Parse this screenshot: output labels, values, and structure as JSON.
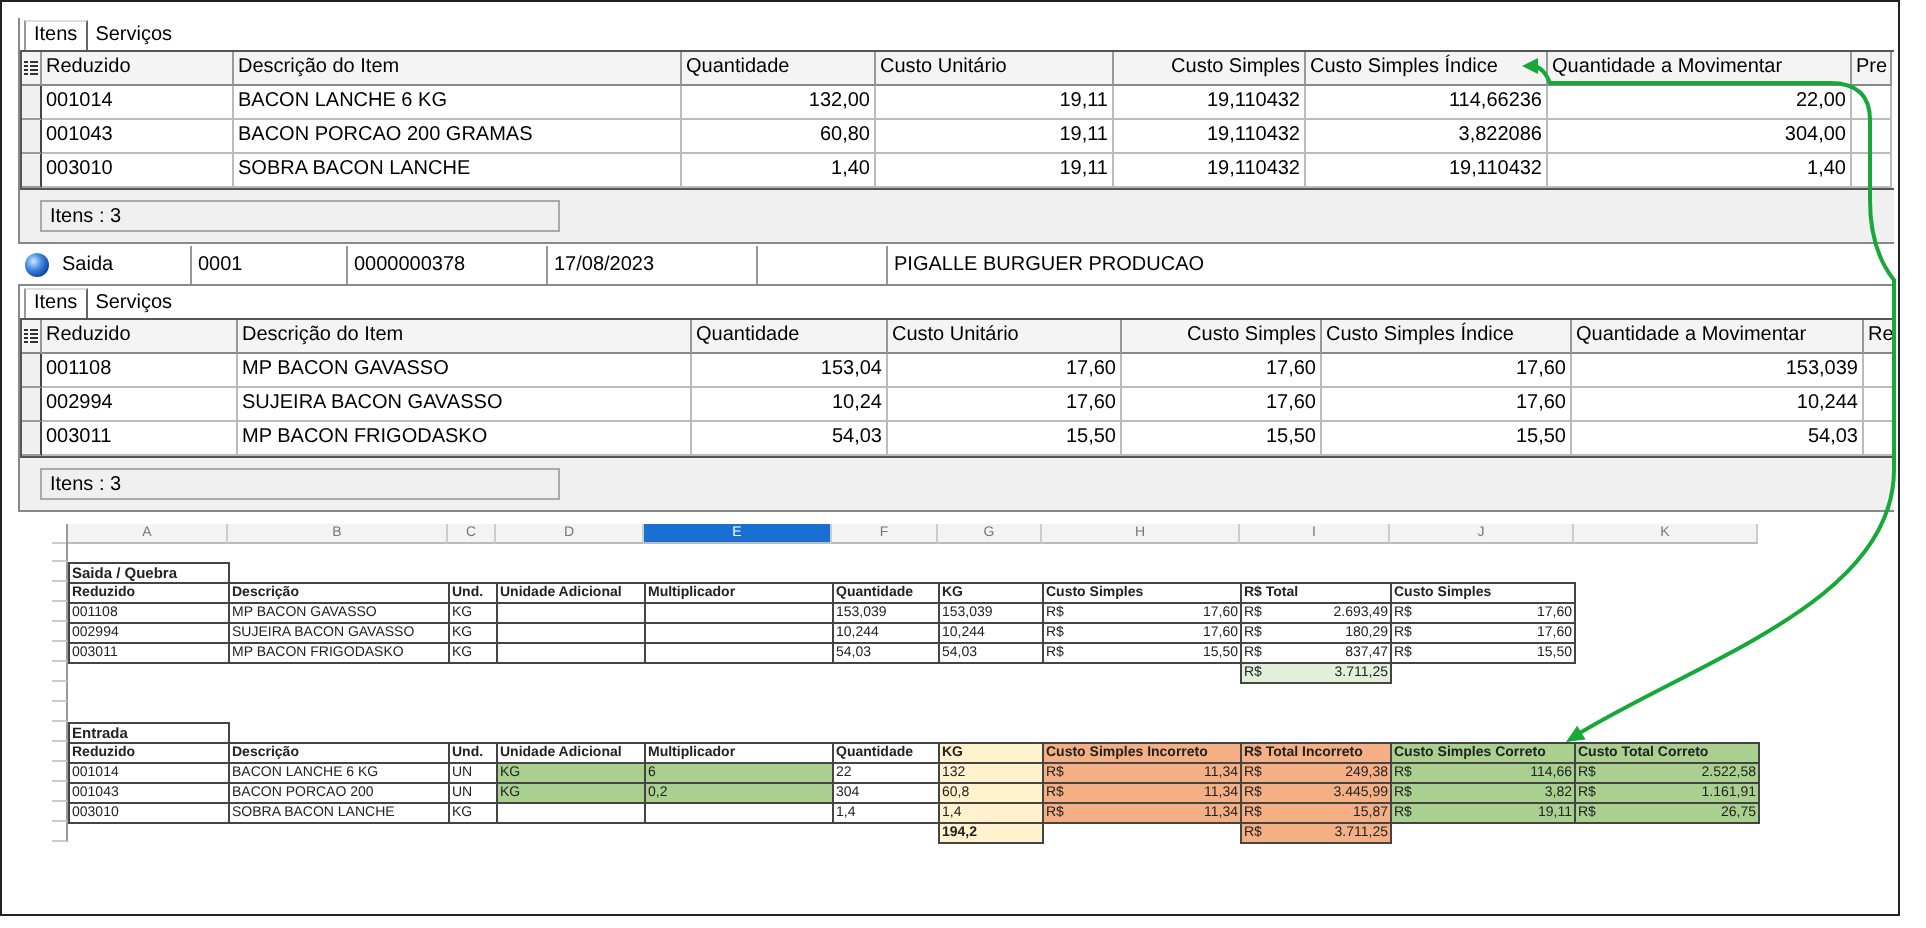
{
  "top_panel": {
    "tabs": [
      {
        "label": "Itens",
        "selected": true
      },
      {
        "label": "Serviços",
        "selected": false
      }
    ],
    "columns": [
      "Reduzido",
      "Descrição do Item",
      "Quantidade",
      "Custo Unitário",
      "Custo Simples",
      "Custo Simples Índice",
      "Quantidade a Movimentar",
      "Pre"
    ],
    "rows": [
      [
        "001014",
        "BACON LANCHE 6 KG",
        "132,00",
        "19,11",
        "19,110432",
        "114,66236",
        "22,00"
      ],
      [
        "001043",
        "BACON PORCAO 200 GRAMAS",
        "60,80",
        "19,11",
        "19,110432",
        "3,822086",
        "304,00"
      ],
      [
        "003010",
        "SOBRA BACON LANCHE",
        "1,40",
        "19,11",
        "19,110432",
        "19,110432",
        "1,40"
      ]
    ],
    "item_count": "Itens : 3"
  },
  "record": {
    "type": "Saida",
    "code": "0001",
    "number": "0000000378",
    "date": "17/08/2023",
    "name": "PIGALLE BURGUER PRODUCAO"
  },
  "bottom_panel": {
    "tabs": [
      {
        "label": "Itens",
        "selected": true
      },
      {
        "label": "Serviços",
        "selected": false
      }
    ],
    "columns": [
      "Reduzido",
      "Descrição do Item",
      "Quantidade",
      "Custo Unitário",
      "Custo Simples",
      "Custo Simples Índice",
      "Quantidade a Movimentar",
      "Re"
    ],
    "rows": [
      [
        "001108",
        "MP BACON GAVASSO",
        "153,04",
        "17,60",
        "17,60",
        "17,60",
        "153,039"
      ],
      [
        "002994",
        "SUJEIRA BACON GAVASSO",
        "10,24",
        "17,60",
        "17,60",
        "17,60",
        "10,244"
      ],
      [
        "003011",
        "MP BACON FRIGODASKO",
        "54,03",
        "15,50",
        "15,50",
        "15,50",
        "54,03"
      ]
    ],
    "item_count": "Itens : 3"
  },
  "spreadsheet": {
    "column_letters": [
      {
        "label": "A",
        "selected": false
      },
      {
        "label": "B",
        "selected": false
      },
      {
        "label": "C",
        "selected": false
      },
      {
        "label": "D",
        "selected": false
      },
      {
        "label": "E",
        "selected": true
      },
      {
        "label": "F",
        "selected": false
      },
      {
        "label": "G",
        "selected": false
      },
      {
        "label": "H",
        "selected": false
      },
      {
        "label": "I",
        "selected": false
      },
      {
        "label": "J",
        "selected": false
      },
      {
        "label": "K",
        "selected": false
      }
    ],
    "sections": [
      {
        "title": "Saida / Quebra",
        "columns": [
          "Reduzido",
          "Descrição",
          "Und.",
          "Unidade Adicional",
          "Multiplicador",
          "Quantidade",
          "KG",
          "Custo Simples",
          "R$ Total",
          "Custo Simples"
        ],
        "rows": [
          {
            "A": "001108",
            "B": "MP BACON GAVASSO",
            "C": "KG",
            "F": "153,039",
            "G": "153,039",
            "H": {
              "currency": "R$",
              "value": "17,60"
            },
            "I": {
              "currency": "R$",
              "value": "2.693,49"
            },
            "J": {
              "currency": "R$",
              "value": "17,60"
            }
          },
          {
            "A": "002994",
            "B": "SUJEIRA BACON GAVASSO",
            "C": "KG",
            "F": "10,244",
            "G": "10,244",
            "H": {
              "currency": "R$",
              "value": "17,60"
            },
            "I": {
              "currency": "R$",
              "value": "180,29"
            },
            "J": {
              "currency": "R$",
              "value": "17,60"
            }
          },
          {
            "A": "003011",
            "B": "MP BACON FRIGODASKO",
            "C": "KG",
            "F": "54,03",
            "G": "54,03",
            "H": {
              "currency": "R$",
              "value": "15,50"
            },
            "I": {
              "currency": "R$",
              "value": "837,47"
            },
            "J": {
              "currency": "R$",
              "value": "15,50"
            }
          }
        ],
        "totals": {
          "I": {
            "currency": "R$",
            "value": "3.711,25",
            "color": "#e2efda"
          }
        }
      },
      {
        "title": "Entrada",
        "columns": [
          "Reduzido",
          "Descrição",
          "Und.",
          "Unidade Adicional",
          "Multiplicador",
          "Quantidade",
          {
            "text": "KG",
            "color": "#fff2cc"
          },
          {
            "text": "Custo Simples Incorreto",
            "color": "#f4b084"
          },
          {
            "text": "R$ Total Incorreto",
            "color": "#f4b084"
          },
          {
            "text": "Custo Simples Correto",
            "color": "#a9d08e"
          },
          {
            "text": "Custo Total Correto",
            "color": "#a9d08e"
          }
        ],
        "rows": [
          {
            "A": "001014",
            "B": "BACON LANCHE 6 KG",
            "C": "UN",
            "D": {
              "text": "KG",
              "color": "#a9d08e"
            },
            "E": {
              "text": "6",
              "color": "#a9d08e"
            },
            "F": "22",
            "G": {
              "text": "132",
              "color": "#fff2cc"
            },
            "H": {
              "currency": "R$",
              "value": "11,34",
              "color": "#f4b084"
            },
            "I": {
              "currency": "R$",
              "value": "249,38",
              "color": "#f4b084"
            },
            "J": {
              "currency": "R$",
              "value": "114,66",
              "color": "#a9d08e"
            },
            "K": {
              "currency": "R$",
              "value": "2.522,58",
              "color": "#a9d08e"
            }
          },
          {
            "A": "001043",
            "B": "BACON PORCAO 200",
            "C": "UN",
            "D": {
              "text": "KG",
              "color": "#a9d08e"
            },
            "E": {
              "text": "0,2",
              "color": "#a9d08e"
            },
            "F": "304",
            "G": {
              "text": "60,8",
              "color": "#fff2cc"
            },
            "H": {
              "currency": "R$",
              "value": "11,34",
              "color": "#f4b084"
            },
            "I": {
              "currency": "R$",
              "value": "3.445,99",
              "color": "#f4b084"
            },
            "J": {
              "currency": "R$",
              "value": "3,82",
              "color": "#a9d08e"
            },
            "K": {
              "currency": "R$",
              "value": "1.161,91",
              "color": "#a9d08e"
            }
          },
          {
            "A": "003010",
            "B": "SOBRA BACON LANCHE",
            "C": "KG",
            "F": "1,4",
            "G": {
              "text": "1,4",
              "color": "#fff2cc"
            },
            "H": {
              "currency": "R$",
              "value": "11,34",
              "color": "#f4b084"
            },
            "I": {
              "currency": "R$",
              "value": "15,87",
              "color": "#f4b084"
            },
            "J": {
              "currency": "R$",
              "value": "19,11",
              "color": "#a9d08e"
            },
            "K": {
              "currency": "R$",
              "value": "26,75",
              "color": "#a9d08e"
            }
          }
        ],
        "totals": {
          "G": {
            "text": "194,2",
            "color": "#fff2cc",
            "bold": true
          },
          "I": {
            "currency": "R$",
            "value": "3.711,25",
            "color": "#f4b084"
          }
        }
      }
    ]
  }
}
